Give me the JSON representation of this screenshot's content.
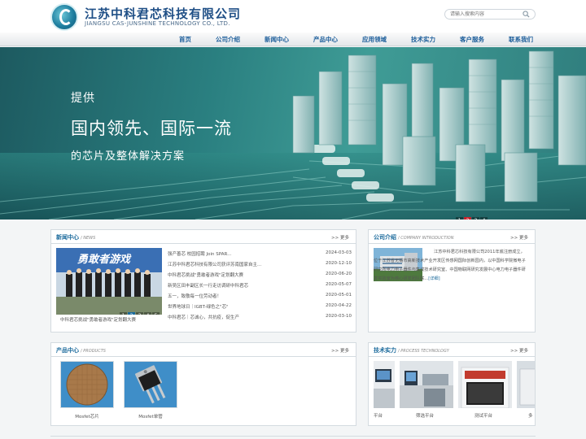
{
  "header": {
    "company_cn": "江苏中科君芯科技有限公司",
    "company_en": "JIANGSU CAS-JUNSHINE TECHNOLOGY CO., LTD.",
    "search_placeholder": "请输入搜索内容"
  },
  "nav": {
    "items": [
      "首页",
      "公司介绍",
      "新闻中心",
      "产品中心",
      "应用领域",
      "技术实力",
      "客户服务",
      "联系我们"
    ]
  },
  "banner": {
    "line1": "提供",
    "line2": "国内领先、国际一流",
    "line3": "的芯片及整体解决方案",
    "slides": [
      "1",
      "2",
      "3",
      "4"
    ],
    "active_slide": 1
  },
  "news": {
    "title": "新闻中心",
    "subtitle": "/ NEWS",
    "more": ">> 更多",
    "photo_banner": "勇敢者游戏",
    "photo_pages": [
      "1",
      "2",
      "3",
      "4",
      "5"
    ],
    "caption": "中科君芯挑战\"勇敢者游戏\"定划翻大赛",
    "items": [
      {
        "title": "强产善芯 校园招聘 Join SPAR...",
        "date": "2024-03-03"
      },
      {
        "title": "江苏中科君芯科技有限公司获评苏南国家自主...",
        "date": "2020-12-10"
      },
      {
        "title": "中科君芯挑战\"勇敢者游戏\"定划翻大赛",
        "date": "2020-06-20"
      },
      {
        "title": "新吴区田丰副区长一行走访调研中科君芯",
        "date": "2020-05-07"
      },
      {
        "title": "五一，致敬每一位劳动者！",
        "date": "2020-05-01"
      },
      {
        "title": "世界地球日｜IGBT-绿色之\"芯\"",
        "date": "2020-04-22"
      },
      {
        "title": "中科君芯｜芯诚心，共抗疫，促生产",
        "date": "2020-03-10"
      }
    ]
  },
  "company": {
    "title": "公司介绍",
    "subtitle": "/ COMPANY INTRODUCTION",
    "more": ">> 更多",
    "text": "江苏中科君芯科技有限公司2011年底注册成立，位于江苏省无锡市高新技术产业开发区传感网国际创新园内，以中国科学院微电子研究所电力电子器件与集成技术研究室、中国物联网研究发展中心电力电子器件研发实验室为核心研发团队联...",
    "detail_link": "[详细]"
  },
  "products": {
    "title": "产品中心",
    "subtitle": "/ PRODUCTS",
    "more": ">> 更多",
    "items": [
      {
        "label": "Mosfet芯片"
      },
      {
        "label": "Mosfet单管"
      }
    ]
  },
  "tech": {
    "title": "技术实力",
    "subtitle": "/ PROCESS TECHNOLOGY",
    "more": ">> 更多",
    "items": [
      {
        "label": "平台"
      },
      {
        "label": "筛选平台"
      },
      {
        "label": "测试平台"
      },
      {
        "label": "多"
      }
    ]
  }
}
